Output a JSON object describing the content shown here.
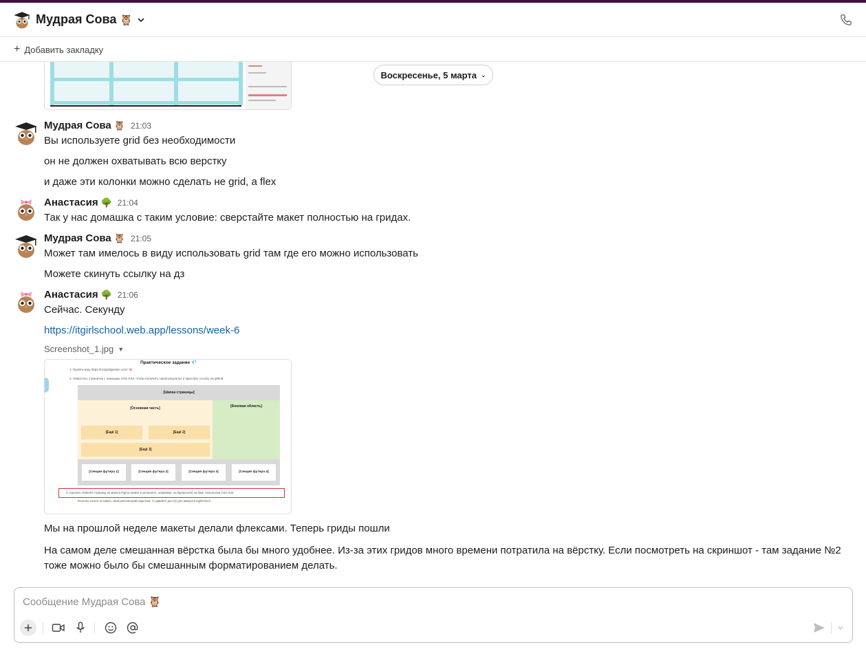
{
  "channel": {
    "title": "Мудрая Сова",
    "title_emoji": "🦉"
  },
  "bookmarks": {
    "add_label": "Добавить закладку"
  },
  "date_divider": {
    "label": "Воскресенье, 5 марта"
  },
  "messages": [
    {
      "author": "Мудрая Сова",
      "emoji": "🦉",
      "time": "21:03",
      "avatar": "owl-graduate",
      "lines": [
        "Вы используете grid без необходимости",
        "он не должен охватывать всю верстку",
        "и даже эти колонки можно сделать не grid, а flex"
      ]
    },
    {
      "author": "Анастасия",
      "emoji": "🌳",
      "time": "21:04",
      "avatar": "owl-bow",
      "lines": [
        "Так у нас домашка с таким условие: сверстайте макет полностью на гридах."
      ]
    },
    {
      "author": "Мудрая Сова",
      "emoji": "🦉",
      "time": "21:05",
      "avatar": "owl-graduate",
      "lines": [
        "Может там имелось в виду использовать grid там где его можно использовать",
        "Можете скинуть ссылку на дз"
      ]
    },
    {
      "author": "Анастасия",
      "emoji": "🌳",
      "time": "21:06",
      "avatar": "owl-bow",
      "lines": [
        "Сейчас. Секунду"
      ],
      "link": "https://itgirlschool.web.app/lessons/week-6",
      "file_name": "Screenshot_1.jpg",
      "after_lines": [
        "Мы на прошлой неделе макеты делали флексами. Теперь гриды пошли",
        "На самом деле смешанная вёрстка была бы много удобнее. Из-за этих гридов много времени потратила на вёрстку. Если посмотреть на скриншот - там задание №2 тоже можно было бы смешанным форматированием делать."
      ]
    }
  ],
  "screenshot": {
    "title": "Практическое задание 💎",
    "step1": "1. Пройти игру https://cssgridgarden.com/ 🦄",
    "step2": "2. Сверстать страничку с помощью CSS Grid, чтобы получить такой результат и прислать ссылку на github:",
    "header": "[Шапка страницы]",
    "main": "[Основная часть]",
    "side": "[Боковая область]",
    "more1": "[Ещё 1]",
    "more2": "[Ещё 2]",
    "more3": "[Ещё 3]",
    "footers": [
      "[Секция футера 1]",
      "[Секция футера 2]",
      "[Секция футера 3]",
      "[Секция футера 4]"
    ],
    "step3": "3. Сделать НОВУЮ страницу из макета Figma (найти в интернете, например, на figmacrush) на базе технологии CSS Grid",
    "note": "Если вы хотите оставить свой репозиторий скрытым, то давайте доступ для аккаунта itgirlschool"
  },
  "composer": {
    "placeholder": "Сообщение Мудрая Сова 🦉"
  },
  "colors": {
    "accent": "#3f0e40",
    "link": "#1264a3"
  }
}
